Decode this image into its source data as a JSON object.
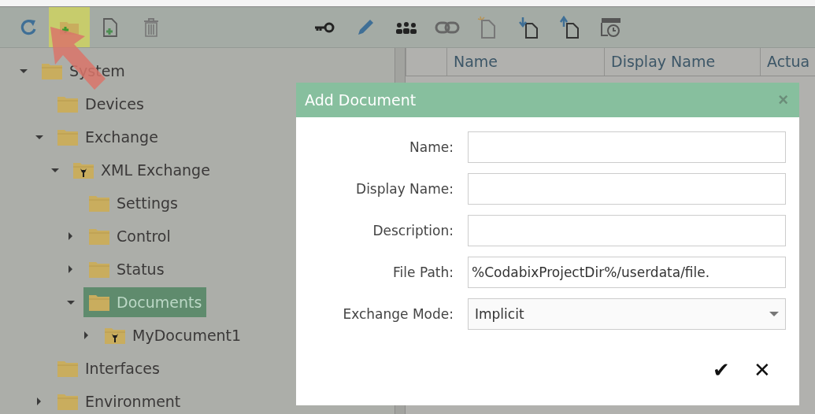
{
  "toolbar": [
    {
      "kind": "refresh",
      "highlighted": false
    },
    {
      "kind": "add-folder",
      "highlighted": true
    },
    {
      "kind": "add-file",
      "highlighted": false
    },
    {
      "kind": "delete",
      "highlighted": false
    },
    {
      "kind": "key",
      "highlighted": false
    },
    {
      "kind": "edit",
      "highlighted": false
    },
    {
      "kind": "users",
      "highlighted": false
    },
    {
      "kind": "link",
      "highlighted": false
    },
    {
      "kind": "new-document",
      "highlighted": false
    },
    {
      "kind": "import",
      "highlighted": false
    },
    {
      "kind": "export",
      "highlighted": false
    },
    {
      "kind": "schedule",
      "highlighted": false
    }
  ],
  "tree": [
    {
      "label": "System",
      "kind": "folder",
      "expanded": true,
      "selected": false,
      "children": [
        {
          "label": "Devices",
          "kind": "folder",
          "selected": false
        },
        {
          "label": "Exchange",
          "kind": "folder",
          "expanded": true,
          "selected": false,
          "children": [
            {
              "label": "XML Exchange",
              "kind": "module",
              "expanded": true,
              "selected": false,
              "children": [
                {
                  "label": "Settings",
                  "kind": "folder",
                  "selected": false
                },
                {
                  "label": "Control",
                  "kind": "folder",
                  "expanded": false,
                  "selected": false
                },
                {
                  "label": "Status",
                  "kind": "folder",
                  "expanded": false,
                  "selected": false
                },
                {
                  "label": "Documents",
                  "kind": "folder",
                  "expanded": true,
                  "selected": true,
                  "children": [
                    {
                      "label": "MyDocument1",
                      "kind": "module",
                      "expanded": false,
                      "selected": false
                    }
                  ]
                }
              ]
            }
          ]
        },
        {
          "label": "Interfaces",
          "kind": "folder",
          "selected": false
        },
        {
          "label": "Environment",
          "kind": "folder",
          "expanded": false,
          "selected": false
        }
      ]
    }
  ],
  "table": {
    "columns": [
      "Name",
      "Display Name",
      "Actua"
    ]
  },
  "dialog": {
    "title": "Add Document",
    "close": "×",
    "fields": [
      {
        "label": "Name:",
        "kind": "text"
      },
      {
        "label": "Display Name:",
        "kind": "text"
      },
      {
        "label": "Description:",
        "kind": "text"
      },
      {
        "label": "File Path:",
        "kind": "text",
        "value": "%CodabixProjectDir%/userdata/file."
      },
      {
        "label": "Exchange Mode:",
        "kind": "select",
        "value": "Implicit"
      }
    ],
    "confirm": "✔",
    "cancel": "✕"
  }
}
